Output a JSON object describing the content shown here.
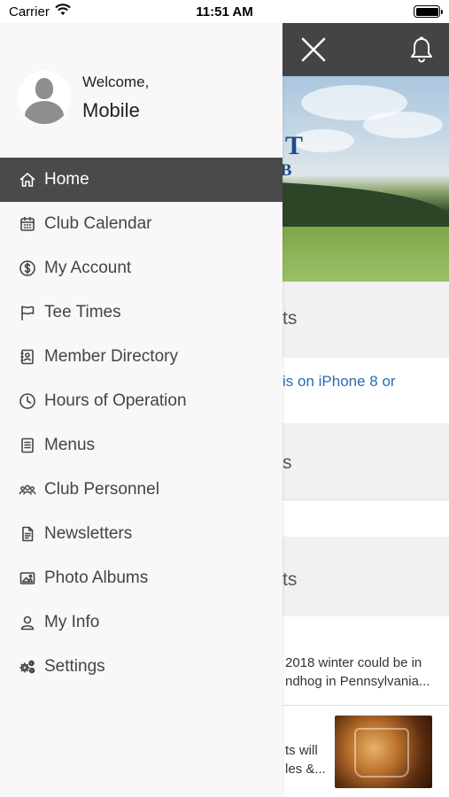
{
  "status_bar": {
    "carrier": "Carrier",
    "time": "11:51 AM"
  },
  "drawer": {
    "welcome": "Welcome,",
    "user_name": "Mobile",
    "menu": [
      {
        "label": "Home",
        "icon": "home-icon",
        "active": true
      },
      {
        "label": "Club Calendar",
        "icon": "calendar-icon"
      },
      {
        "label": "My Account",
        "icon": "dollar-circle-icon"
      },
      {
        "label": "Tee Times",
        "icon": "flag-icon"
      },
      {
        "label": "Member Directory",
        "icon": "contact-book-icon"
      },
      {
        "label": "Hours of Operation",
        "icon": "clock-icon"
      },
      {
        "label": "Menus",
        "icon": "menu-book-icon"
      },
      {
        "label": "Club Personnel",
        "icon": "people-icon"
      },
      {
        "label": "Newsletters",
        "icon": "document-icon"
      },
      {
        "label": "Photo Albums",
        "icon": "image-icon"
      },
      {
        "label": "My Info",
        "icon": "user-icon"
      },
      {
        "label": "Settings",
        "icon": "gears-icon"
      }
    ]
  },
  "background": {
    "hero_logo_line1": "ET",
    "hero_logo_line2": "UB",
    "section1_title": "ts",
    "section1_link": "is on iPhone 8 or",
    "section2_title": "s",
    "section3_title": "ts",
    "news1_line1": "2018 winter could be in",
    "news1_line2": "ndhog in Pennsylvania...",
    "news2_line1": "ts will",
    "news2_line2": "les &..."
  },
  "colors": {
    "active_bg": "#4a4a4a",
    "topbar": "#444444",
    "drawer_bg": "#f8f8f8",
    "link": "#2b6cb0"
  }
}
